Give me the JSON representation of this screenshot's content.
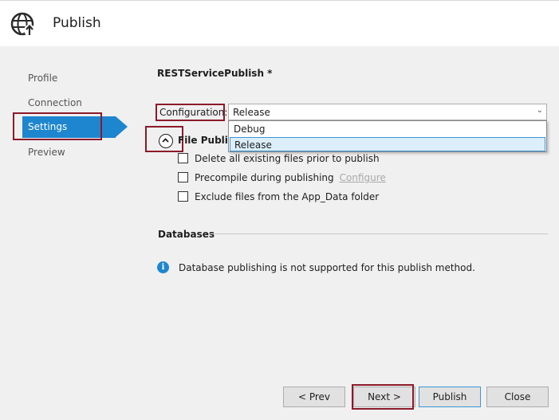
{
  "header": {
    "title": "Publish",
    "icon": "globe-publish-icon"
  },
  "nav": {
    "items": [
      {
        "label": "Profile"
      },
      {
        "label": "Connection"
      },
      {
        "label": "Settings",
        "selected": true
      },
      {
        "label": "Preview"
      }
    ]
  },
  "settings": {
    "profile_name": "RESTServicePublish *",
    "configuration": {
      "label": "Configuration:",
      "value": "Release",
      "options": [
        "Debug",
        "Release"
      ]
    },
    "file_publish": {
      "title": "File Publish",
      "options": [
        {
          "label": "Delete all existing files prior to publish",
          "checked": false
        },
        {
          "label": "Precompile during publishing",
          "checked": false,
          "link": "Configure"
        },
        {
          "label": "Exclude files from the App_Data folder",
          "checked": false
        }
      ]
    },
    "databases": {
      "title": "Databases",
      "message": "Database publishing is not supported for this publish method."
    }
  },
  "footer": {
    "prev": "< Prev",
    "next": "Next >",
    "publish": "Publish",
    "close": "Close"
  },
  "colors": {
    "accent": "#1e86cf",
    "highlight_box": "#8b1a2a"
  }
}
